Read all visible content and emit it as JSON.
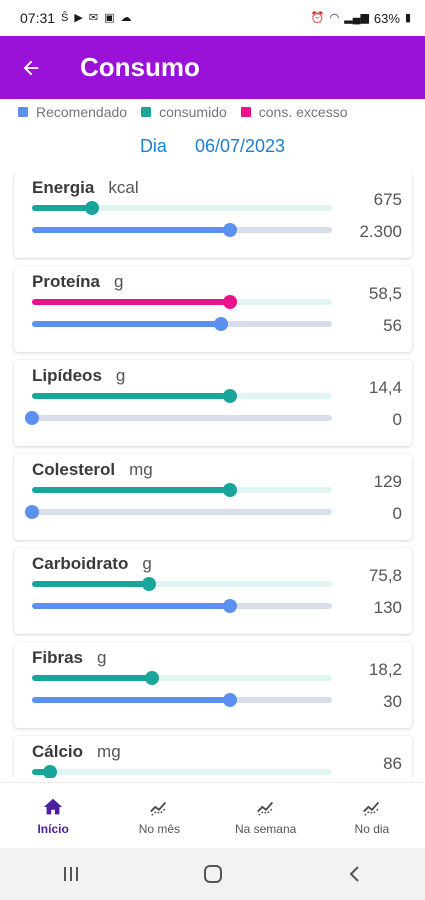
{
  "status": {
    "time": "07:31",
    "battery": "63%",
    "left_icons": [
      "s-icon",
      "youtube-icon",
      "mail-icon",
      "gallery-icon",
      "cloud-icon"
    ]
  },
  "appbar": {
    "title": "Consumo"
  },
  "legend": [
    {
      "label": "Recomendado",
      "color": "#5b8ff0"
    },
    {
      "label": "consumido",
      "color": "#1aa59a"
    },
    {
      "label": "cons. excesso",
      "color": "#e8128a"
    }
  ],
  "date": {
    "label": "Dia",
    "value": "06/07/2023"
  },
  "nutrients": [
    {
      "name": "Energia",
      "unit": "kcal",
      "consumed": "675",
      "recommended": "2.300",
      "consumed_frac": 0.2,
      "recommended_frac": 0.66,
      "excess": false
    },
    {
      "name": "Proteína",
      "unit": "g",
      "consumed": "58,5",
      "recommended": "56",
      "consumed_frac": 0.66,
      "recommended_frac": 0.63,
      "excess": true
    },
    {
      "name": "Lipídeos",
      "unit": "g",
      "consumed": "14,4",
      "recommended": "0",
      "consumed_frac": 0.66,
      "recommended_frac": 0.0,
      "excess": false
    },
    {
      "name": "Colesterol",
      "unit": "mg",
      "consumed": "129",
      "recommended": "0",
      "consumed_frac": 0.66,
      "recommended_frac": 0.0,
      "excess": false
    },
    {
      "name": "Carboidrato",
      "unit": "g",
      "consumed": "75,8",
      "recommended": "130",
      "consumed_frac": 0.39,
      "recommended_frac": 0.66,
      "excess": false
    },
    {
      "name": "Fibras",
      "unit": "g",
      "consumed": "18,2",
      "recommended": "30",
      "consumed_frac": 0.4,
      "recommended_frac": 0.66,
      "excess": false
    },
    {
      "name": "Cálcio",
      "unit": "mg",
      "consumed": "86",
      "recommended": "",
      "consumed_frac": 0.06,
      "recommended_frac": 0.0,
      "excess": false
    }
  ],
  "bottom_nav": [
    {
      "label": "Início",
      "icon": "home-icon",
      "active": true
    },
    {
      "label": "No mês",
      "icon": "trend-icon",
      "active": false
    },
    {
      "label": "Na semana",
      "icon": "trend-icon",
      "active": false
    },
    {
      "label": "No dia",
      "icon": "trend-icon",
      "active": false
    }
  ],
  "colors": {
    "appbar": "#9a12d8",
    "recommended": "#5b8ff0",
    "consumed": "#1aa59a",
    "excess": "#e8128a",
    "date": "#1e7fce",
    "nav_active": "#4b1fa0"
  }
}
